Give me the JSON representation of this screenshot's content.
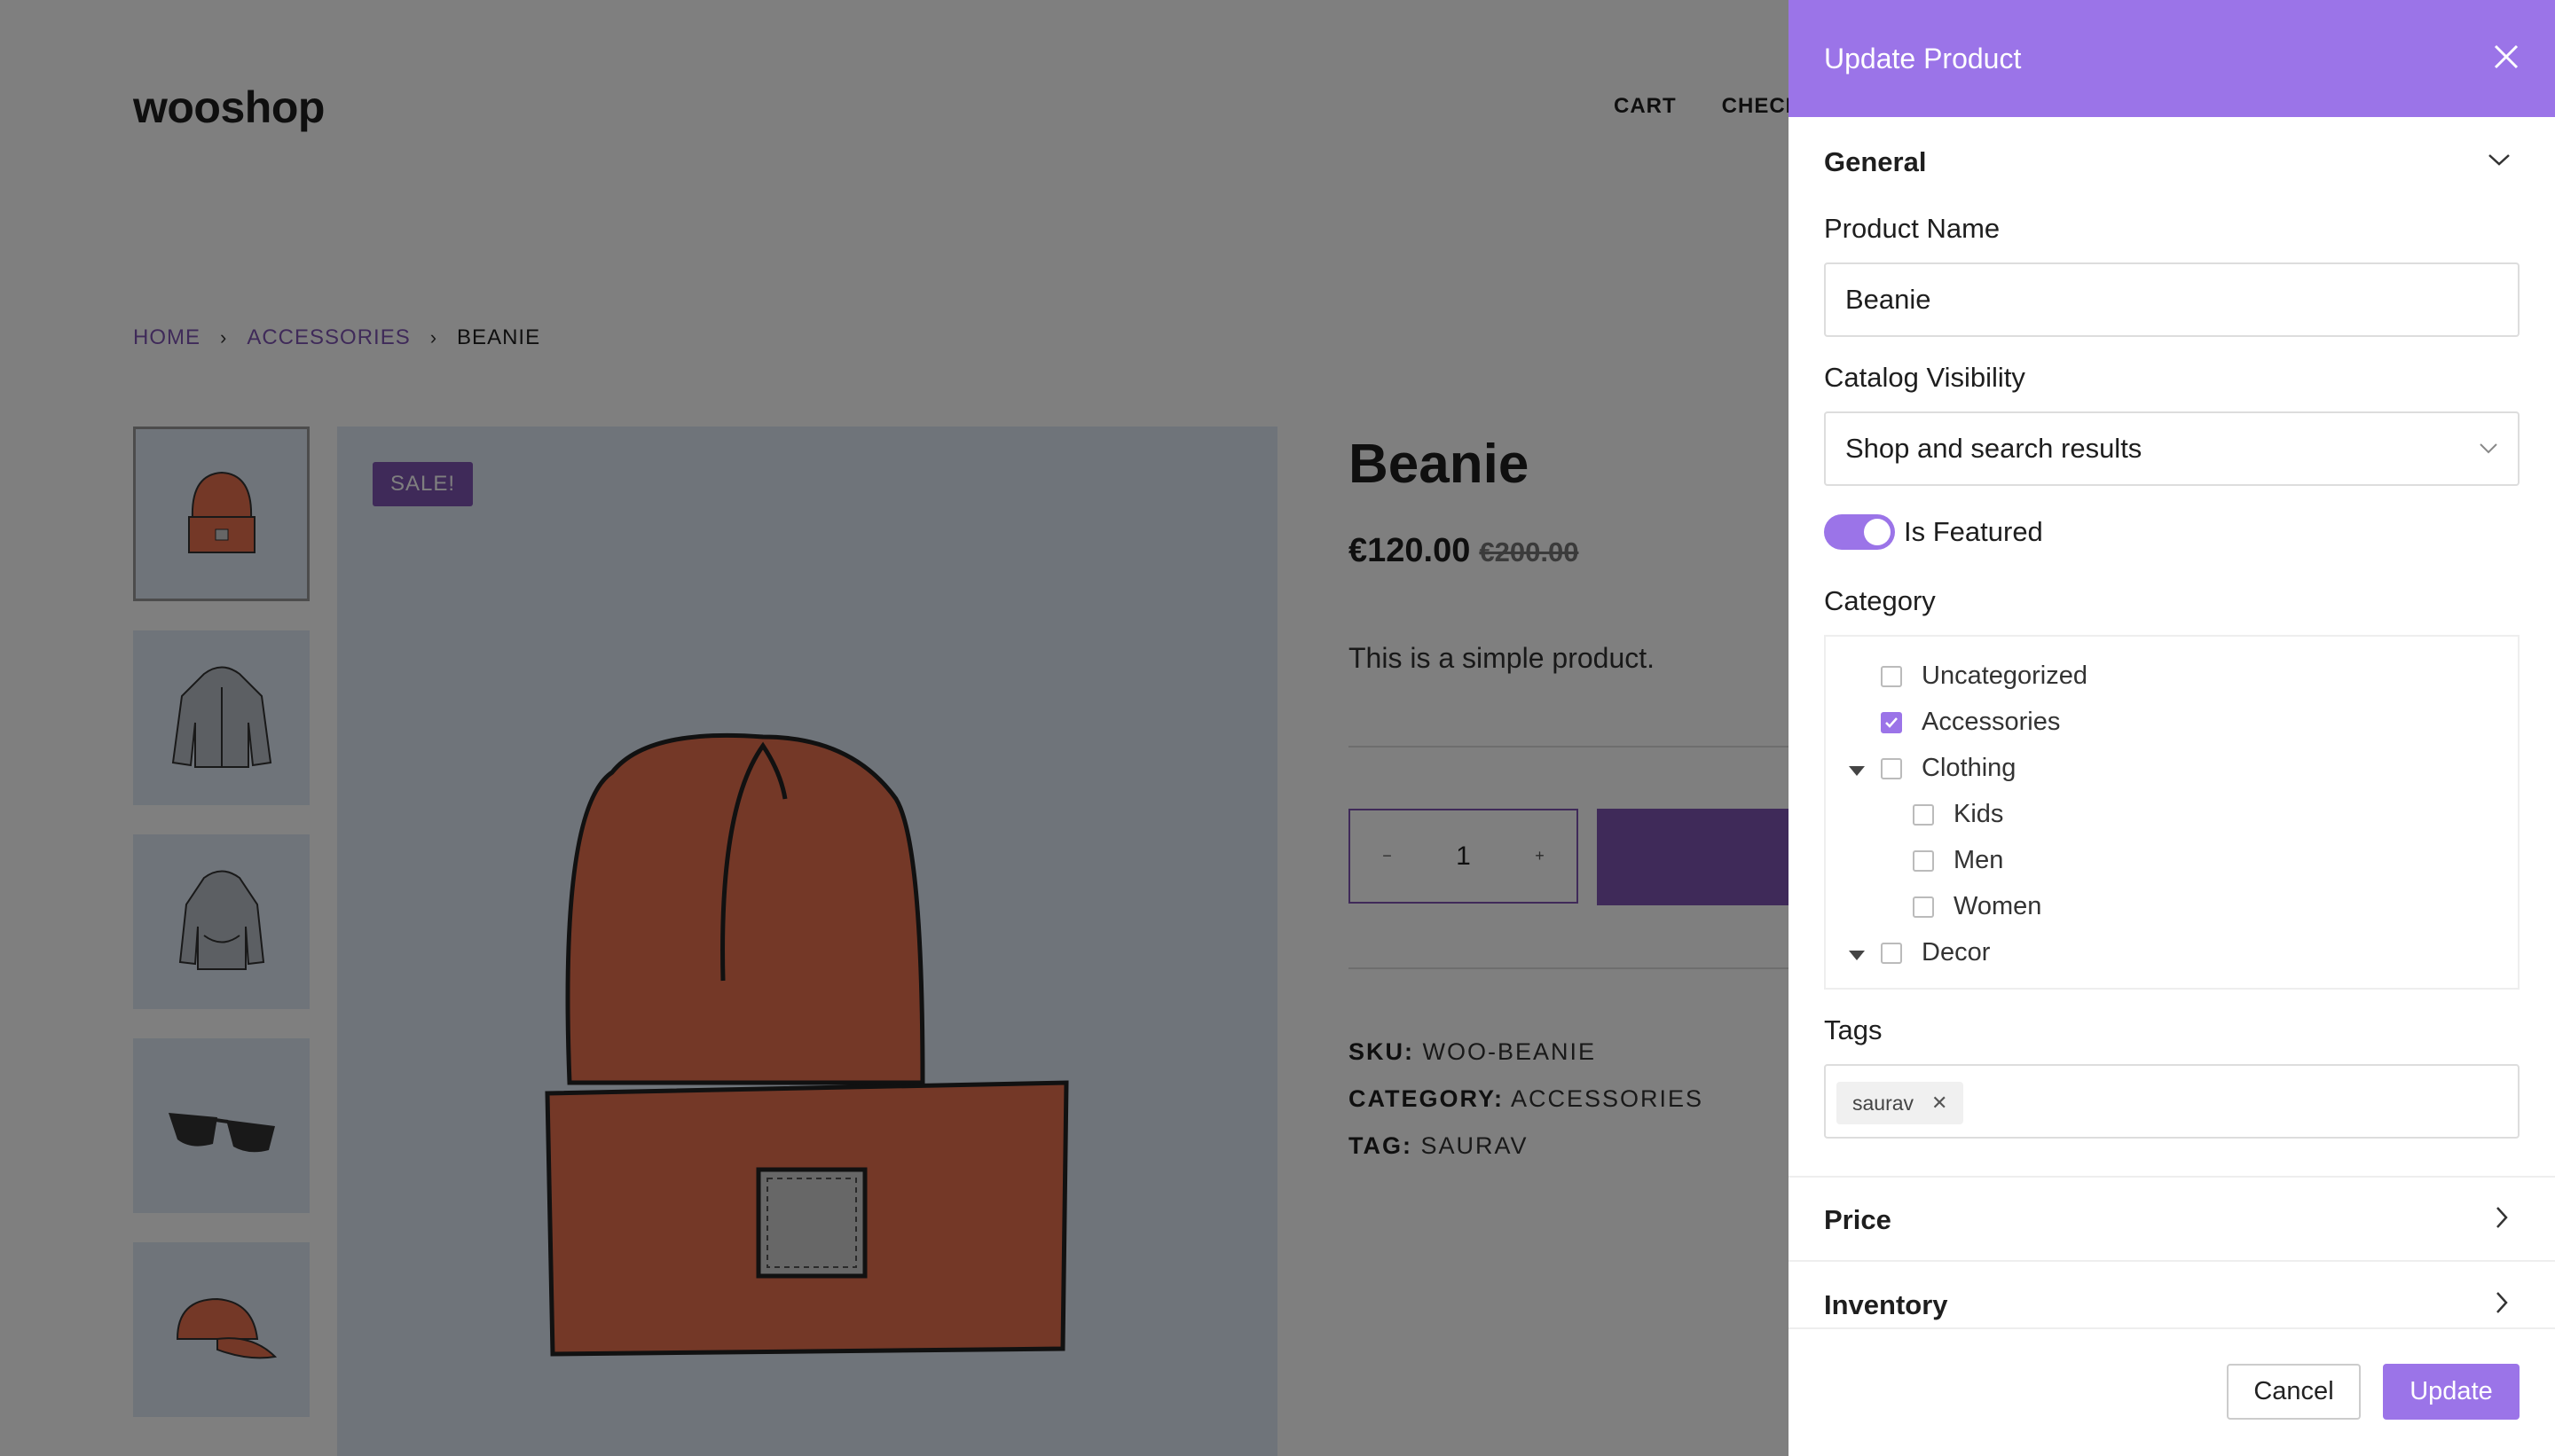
{
  "shop": {
    "logo": "wooshop",
    "nav": [
      "CART",
      "CHECK"
    ],
    "breadcrumb": {
      "home": "HOME",
      "category": "ACCESSORIES",
      "current": "BEANIE"
    },
    "badge": "SALE!",
    "product": {
      "title": "Beanie",
      "price": "€120.00",
      "old_price": "€200.00",
      "description": "This is a simple product.",
      "quantity": "1",
      "sku_label": "SKU:",
      "sku": "WOO-BEANIE",
      "category_label": "CATEGORY:",
      "category": "ACCESSORIES",
      "tag_label": "TAG:",
      "tag": "SAURAV"
    },
    "thumbnails": [
      "beanie",
      "hoodie-zip",
      "hoodie",
      "sunglasses",
      "cap"
    ]
  },
  "drawer": {
    "title": "Update Product",
    "general": {
      "heading": "General",
      "product_name_label": "Product Name",
      "product_name": "Beanie",
      "visibility_label": "Catalog Visibility",
      "visibility": "Shop and search results",
      "featured_label": "Is Featured",
      "featured": true,
      "category_label": "Category",
      "categories": [
        {
          "label": "Uncategorized",
          "checked": false
        },
        {
          "label": "Accessories",
          "checked": true
        },
        {
          "label": "Clothing",
          "checked": false,
          "expanded": true
        },
        {
          "label": "Kids",
          "checked": false
        },
        {
          "label": "Men",
          "checked": false
        },
        {
          "label": "Women",
          "checked": false
        },
        {
          "label": "Decor",
          "checked": false,
          "expanded": true
        }
      ],
      "tags_label": "Tags",
      "tags": [
        "saurav"
      ]
    },
    "price_heading": "Price",
    "inventory_heading": "Inventory",
    "cancel": "Cancel",
    "update": "Update"
  },
  "colors": {
    "accent": "#9b74e8",
    "brand": "#7f54b3",
    "image_bg": "#dfe8f4"
  }
}
